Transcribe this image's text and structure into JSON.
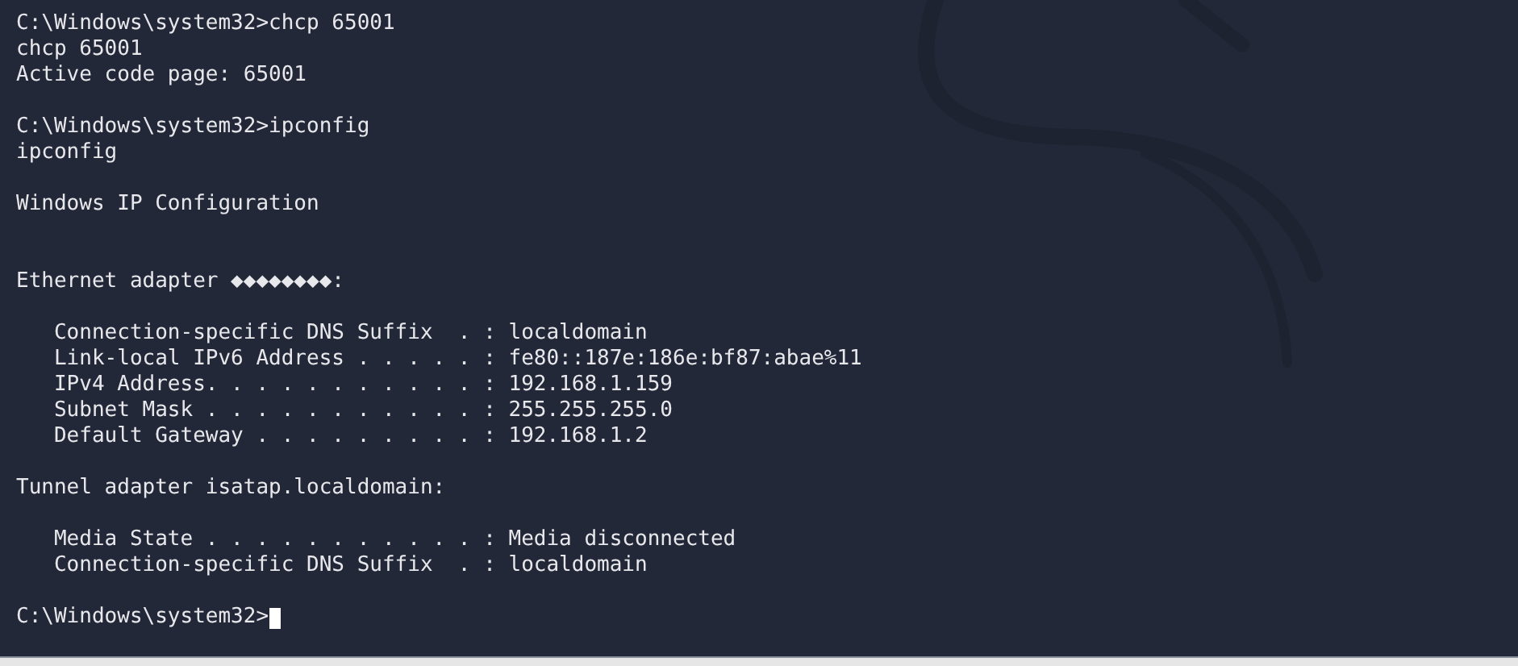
{
  "terminal": {
    "lines": [
      {
        "kind": "text",
        "text": "C:\\Windows\\system32>chcp 65001"
      },
      {
        "kind": "text",
        "text": "chcp 65001"
      },
      {
        "kind": "text",
        "text": "Active code page: 65001"
      },
      {
        "kind": "blank"
      },
      {
        "kind": "text",
        "text": "C:\\Windows\\system32>ipconfig"
      },
      {
        "kind": "text",
        "text": "ipconfig"
      },
      {
        "kind": "blank"
      },
      {
        "kind": "text",
        "text": "Windows IP Configuration"
      },
      {
        "kind": "blank"
      },
      {
        "kind": "blank"
      },
      {
        "kind": "text",
        "text": "Ethernet adapter ◆◆◆◆◆◆◆◆:"
      },
      {
        "kind": "blank"
      },
      {
        "kind": "text",
        "text": "   Connection-specific DNS Suffix  . : localdomain"
      },
      {
        "kind": "text",
        "text": "   Link-local IPv6 Address . . . . . : fe80::187e:186e:bf87:abae%11"
      },
      {
        "kind": "text",
        "text": "   IPv4 Address. . . . . . . . . . . : 192.168.1.159"
      },
      {
        "kind": "text",
        "text": "   Subnet Mask . . . . . . . . . . . : 255.255.255.0"
      },
      {
        "kind": "text",
        "text": "   Default Gateway . . . . . . . . . : 192.168.1.2"
      },
      {
        "kind": "blank"
      },
      {
        "kind": "text",
        "text": "Tunnel adapter isatap.localdomain:"
      },
      {
        "kind": "blank"
      },
      {
        "kind": "text",
        "text": "   Media State . . . . . . . . . . . : Media disconnected"
      },
      {
        "kind": "text",
        "text": "   Connection-specific DNS Suffix  . : localdomain"
      },
      {
        "kind": "blank"
      },
      {
        "kind": "text",
        "text": "C:\\Windows\\system32>",
        "cursor": true
      }
    ]
  }
}
